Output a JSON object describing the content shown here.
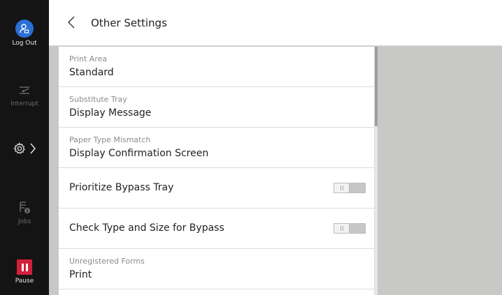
{
  "sidebar": {
    "logout_label": "Log Out",
    "interrupt_label": "Interrupt",
    "jobs_label": "Jobs",
    "pause_label": "Pause",
    "logout_icon": "user-logout-icon",
    "interrupt_icon": "interrupt-icon",
    "settings_icon": "gear-icon",
    "jobs_icon": "jobs-icon",
    "pause_icon": "pause-icon",
    "colors": {
      "logout_accent": "#2b6fd6",
      "pause_accent": "#d21f3c"
    }
  },
  "header": {
    "title": "Other Settings",
    "back_icon": "chevron-left-icon"
  },
  "settings": {
    "print_area": {
      "label": "Print Area",
      "value": "Standard"
    },
    "substitute_tray": {
      "label": "Substitute Tray",
      "value": "Display Message"
    },
    "paper_type_mismatch": {
      "label": "Paper Type Mismatch",
      "value": "Display Confirmation Screen"
    },
    "prioritize_bypass_tray": {
      "label": "Prioritize Bypass Tray",
      "state": "off"
    },
    "check_type_size_bypass": {
      "label": "Check Type and Size for Bypass",
      "state": "off"
    },
    "unregistered_forms": {
      "label": "Unregistered Forms",
      "value": "Print"
    }
  }
}
